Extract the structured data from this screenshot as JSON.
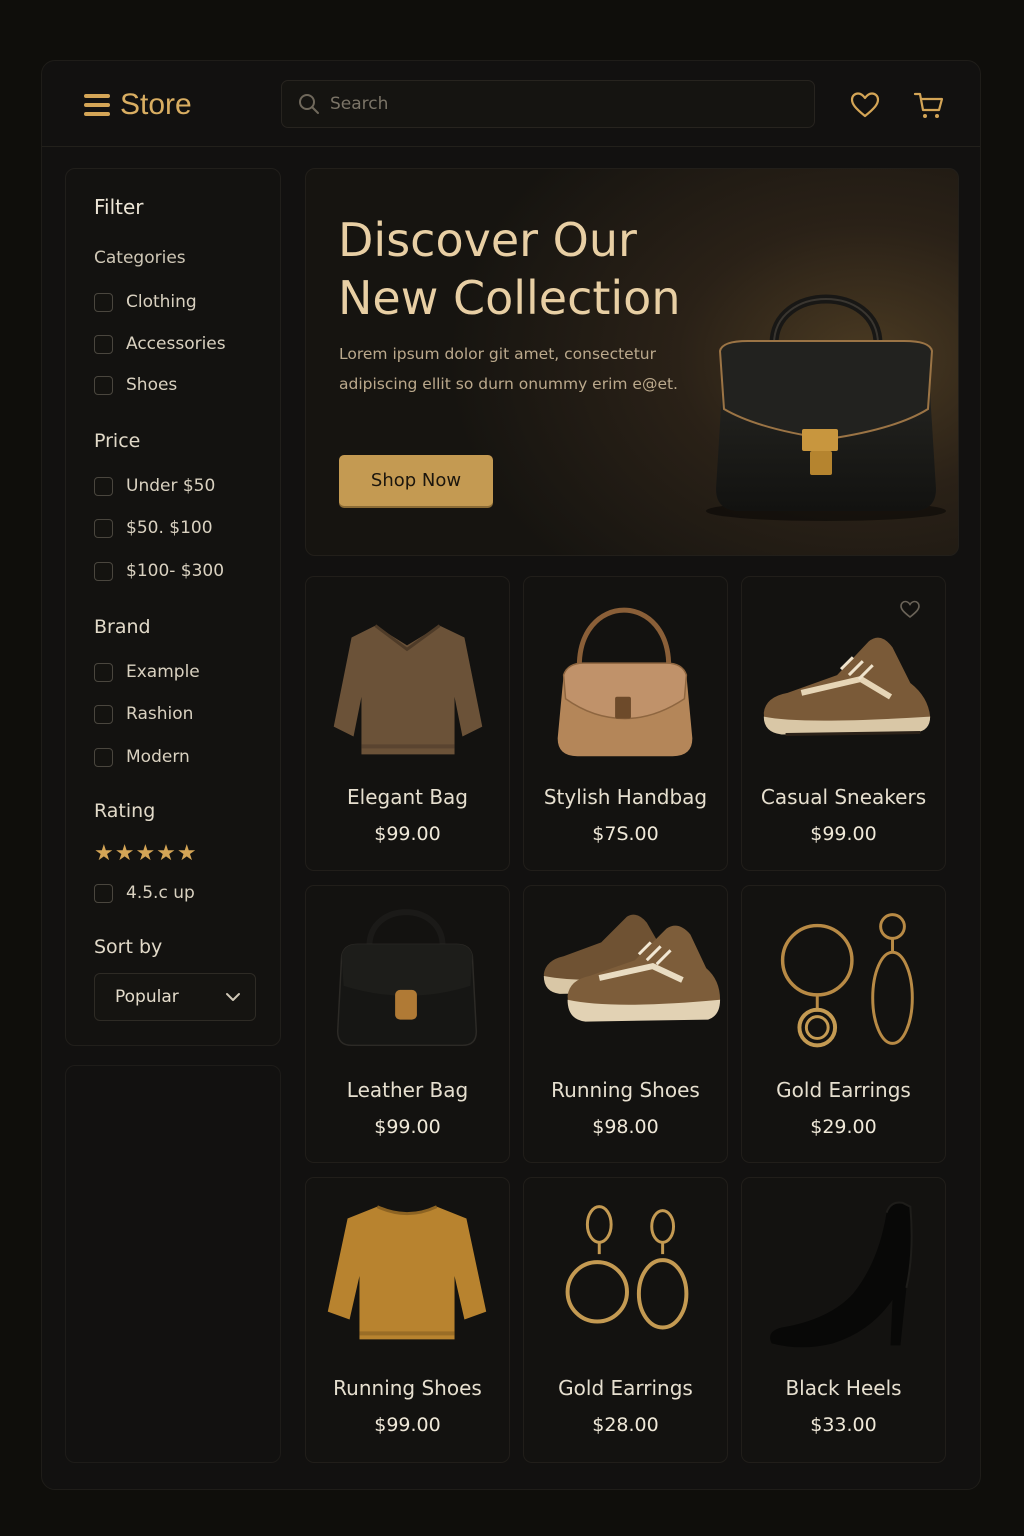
{
  "header": {
    "logo_text": "Store",
    "search_placeholder": "Search"
  },
  "sidebar": {
    "title": "Filter",
    "categories": {
      "label": "Categories",
      "options": [
        "Clothing",
        "Accessories",
        "Shoes"
      ]
    },
    "price": {
      "label": "Price",
      "options": [
        "Under $50",
        "$50. $100",
        "$100- $300"
      ]
    },
    "brand": {
      "label": "Brand",
      "options": [
        "Example",
        "Rashion",
        "Modern"
      ]
    },
    "rating": {
      "label": "Rating",
      "stars": "★★★★★",
      "option": "4.5.c up"
    },
    "sort": {
      "label": "Sort by",
      "value": "Popular"
    }
  },
  "hero": {
    "title_line1": "Discover Our",
    "title_line2": "New Collection",
    "description": "Lorem ipsum dolor git amet, consectetur adipiscing ellit so durn onummy erim e@et.",
    "cta": "Shop Now"
  },
  "products": [
    {
      "name": "Elegant Bag",
      "price": "$99.00",
      "icon": "sweater-icon"
    },
    {
      "name": "Stylish Handbag",
      "price": "$7S.00",
      "icon": "handbag-icon"
    },
    {
      "name": "Casual Sneakers",
      "price": "$99.00",
      "icon": "sneaker-icon"
    },
    {
      "name": "Leather Bag",
      "price": "$99.00",
      "icon": "leather-bag-icon"
    },
    {
      "name": "Running Shoes",
      "price": "$98.00",
      "icon": "running-shoes-icon"
    },
    {
      "name": "Gold Earrings",
      "price": "$29.00",
      "icon": "earrings-icon"
    },
    {
      "name": "Running Shoes",
      "price": "$99.00",
      "icon": "sweater-icon"
    },
    {
      "name": "Gold Earrings",
      "price": "$28.00",
      "icon": "earrings-icon"
    },
    {
      "name": "Black Heels",
      "price": "$33.00",
      "icon": "heels-icon"
    }
  ],
  "colors": {
    "accent": "#d4a556",
    "background": "#0f0e0b",
    "card": "#131210",
    "button": "#c49a52"
  }
}
